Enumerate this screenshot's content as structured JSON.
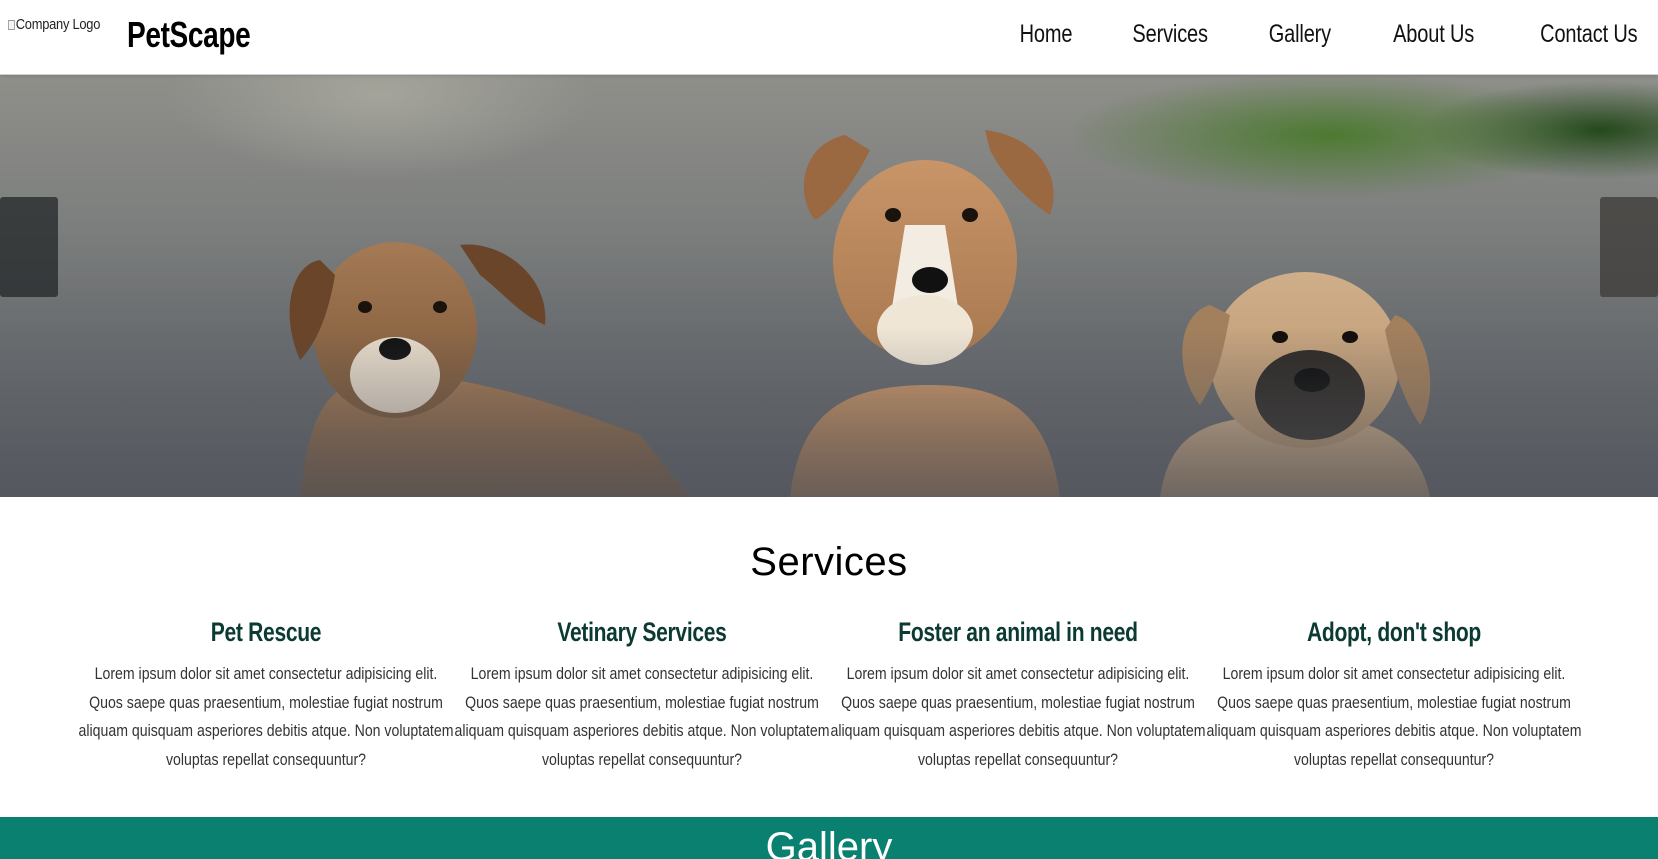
{
  "header": {
    "logo_alt": "Company Logo",
    "brand": "PetScape",
    "nav": [
      {
        "label": "Home"
      },
      {
        "label": "Services"
      },
      {
        "label": "Gallery"
      },
      {
        "label": "About Us"
      },
      {
        "label": "Contact Us"
      }
    ]
  },
  "hero": {
    "image_subject": "three-puppies-photo",
    "prev_icon": "chevron-left-icon",
    "next_icon": "chevron-right-icon"
  },
  "services": {
    "title": "Services",
    "items": [
      {
        "title": "Pet Rescue",
        "text": "Lorem ipsum dolor sit amet consectetur adipisicing elit. Quos saepe quas praesentium, molestiae fugiat nostrum aliquam quisquam asperiores debitis atque. Non voluptatem voluptas repellat consequuntur?"
      },
      {
        "title": "Vetinary Services",
        "text": "Lorem ipsum dolor sit amet consectetur adipisicing elit. Quos saepe quas praesentium, molestiae fugiat nostrum aliquam quisquam asperiores debitis atque. Non voluptatem voluptas repellat consequuntur?"
      },
      {
        "title": "Foster an animal in need",
        "text": "Lorem ipsum dolor sit amet consectetur adipisicing elit. Quos saepe quas praesentium, molestiae fugiat nostrum aliquam quisquam asperiores debitis atque. Non voluptatem voluptas repellat consequuntur?"
      },
      {
        "title": "Adopt, don't shop",
        "text": "Lorem ipsum dolor sit amet consectetur adipisicing elit. Quos saepe quas praesentium, molestiae fugiat nostrum aliquam quisquam asperiores debitis atque. Non voluptatem voluptas repellat consequuntur?"
      }
    ]
  },
  "gallery": {
    "title": "Gallery"
  },
  "colors": {
    "accent_teal": "#0a8170",
    "heading_dark_green": "#0b3a32"
  }
}
